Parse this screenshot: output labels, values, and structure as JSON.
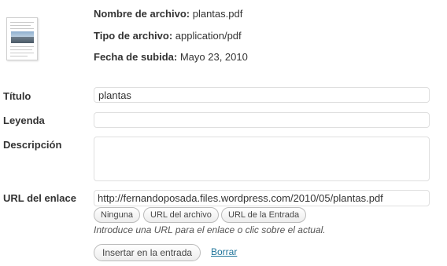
{
  "file_info": {
    "name_label": "Nombre de archivo:",
    "name_value": "plantas.pdf",
    "type_label": "Tipo de archivo:",
    "type_value": "application/pdf",
    "date_label": "Fecha de subida:",
    "date_value": "Mayo 23, 2010",
    "thumbnail_icon": "pdf-document-thumbnail-icon"
  },
  "form": {
    "title_label": "Título",
    "title_value": "plantas",
    "caption_label": "Leyenda",
    "caption_value": "",
    "description_label": "Descripción",
    "description_value": "",
    "link_url_label": "URL del enlace",
    "link_url_value": "http://fernandoposada.files.wordpress.com/2010/05/plantas.pdf",
    "buttons": {
      "none": "Ninguna",
      "file_url": "URL del archivo",
      "post_url": "URL de la Entrada"
    },
    "hint": "Introduce una URL para el enlace o clic sobre el actual."
  },
  "actions": {
    "insert": "Insertar en la entrada",
    "delete": "Borrar"
  },
  "colors": {
    "link": "#21759b",
    "field_border": "#dfdfdf",
    "text": "#333333"
  }
}
